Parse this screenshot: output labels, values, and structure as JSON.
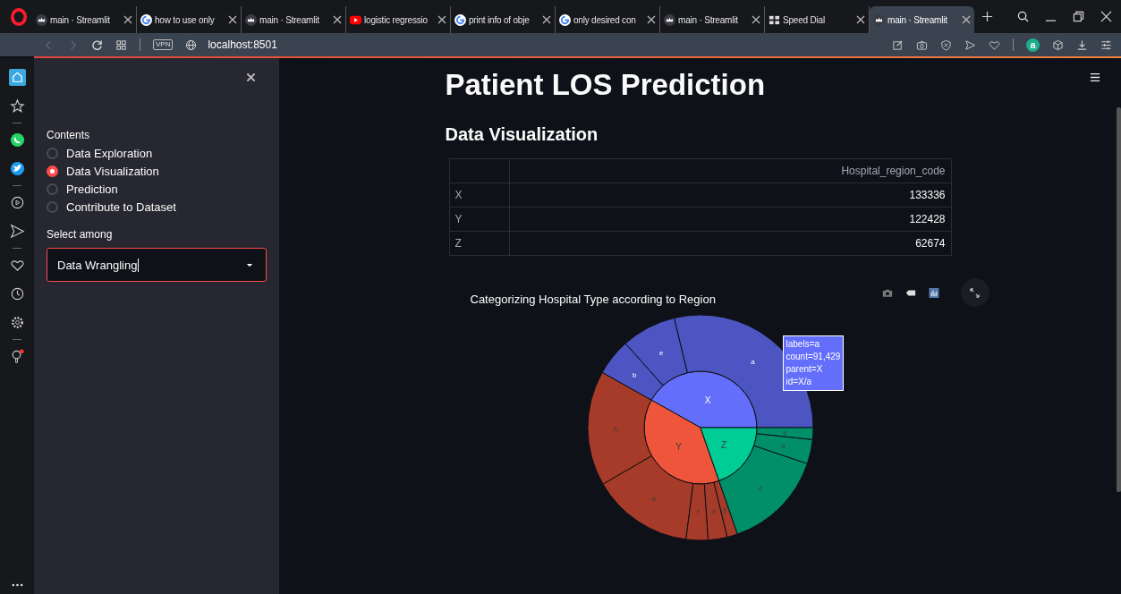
{
  "browser": {
    "tabs": [
      {
        "kind": "crown",
        "title": "main · Streamlit",
        "selected": false
      },
      {
        "kind": "g",
        "title": "how to use only",
        "selected": false
      },
      {
        "kind": "crown",
        "title": "main · Streamlit",
        "selected": false
      },
      {
        "kind": "video",
        "title": "logistic regressio",
        "selected": false
      },
      {
        "kind": "g",
        "title": "print info of obje",
        "selected": false
      },
      {
        "kind": "g",
        "title": "only desired con",
        "selected": false
      },
      {
        "kind": "crown",
        "title": "main · Streamlit",
        "selected": false
      },
      {
        "kind": "dial",
        "title": "Speed Dial",
        "selected": false
      },
      {
        "kind": "crown",
        "title": "main · Streamlit",
        "selected": true
      }
    ],
    "vpn": "VPN",
    "url": "localhost:8501",
    "account": "a"
  },
  "sidebar": {
    "section_label": "Contents",
    "radios": [
      {
        "label": "Data Exploration",
        "selected": false
      },
      {
        "label": "Data Visualization",
        "selected": true
      },
      {
        "label": "Prediction",
        "selected": false
      },
      {
        "label": "Contribute to Dataset",
        "selected": false
      }
    ],
    "select": {
      "label": "Select among",
      "value": "Data Wrangling"
    }
  },
  "main": {
    "title": "Patient LOS Prediction",
    "subtitle": "Data Visualization",
    "table": {
      "columns": [
        "Hospital_region_code"
      ],
      "rows": [
        {
          "index": "X",
          "value": "133336"
        },
        {
          "index": "Y",
          "value": "122428"
        },
        {
          "index": "Z",
          "value": "62674"
        }
      ]
    },
    "chart": {
      "title": "Categorizing Hospital Type according to Region",
      "segments": [
        {
          "label": "X",
          "color": "#636efa",
          "children": [
            {
              "label": "a"
            },
            {
              "label": "e"
            },
            {
              "label": "b"
            }
          ]
        },
        {
          "label": "Y",
          "color": "#ef553b",
          "children": [
            {
              "label": "b"
            },
            {
              "label": "a"
            },
            {
              "label": "f"
            },
            {
              "label": "d"
            },
            {
              "label": "g"
            }
          ]
        },
        {
          "label": "Z",
          "color": "#00cc96",
          "children": [
            {
              "label": "c"
            },
            {
              "label": "d"
            },
            {
              "label": "e"
            }
          ]
        }
      ],
      "tooltip": [
        "labels=a",
        "count=91,429",
        "parent=X",
        "id=X/a"
      ]
    }
  }
}
